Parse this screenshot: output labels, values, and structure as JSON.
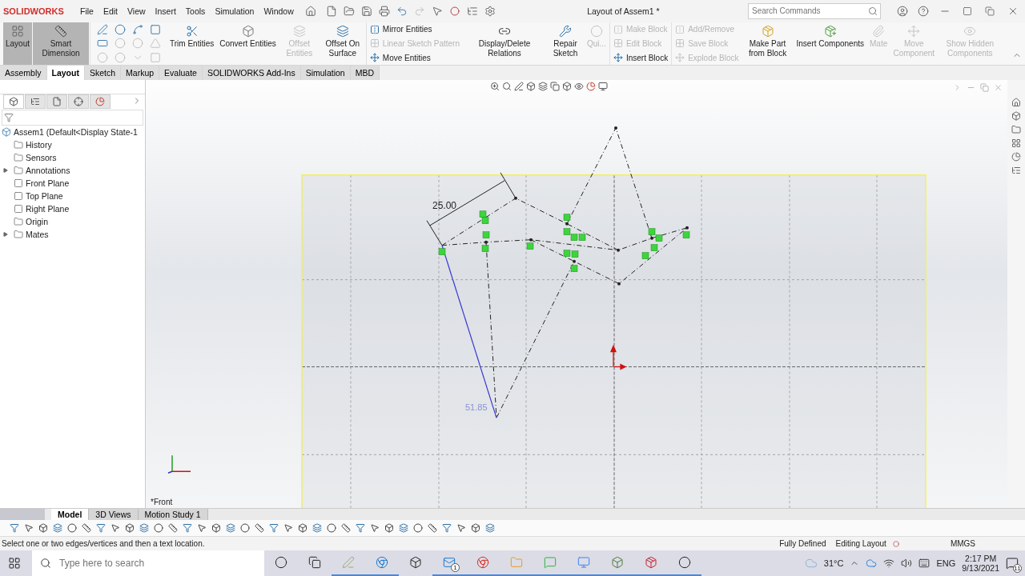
{
  "title_bar": {
    "brand": "SOLIDWORKS",
    "menu": [
      "File",
      "Edit",
      "View",
      "Insert",
      "Tools",
      "Simulation",
      "Window"
    ],
    "title": "Layout of Assem1 *",
    "search": {
      "placeholder": "Search Commands"
    }
  },
  "ribbon": [
    {
      "kind": "large",
      "label": "Layout",
      "selected": true,
      "disabled": false
    },
    {
      "kind": "large",
      "label": "Smart Dimension",
      "selected": true,
      "disabled": false
    },
    {
      "kind": "sketch_tools"
    },
    {
      "kind": "large",
      "label": "Trim Entities",
      "selected": false,
      "disabled": false
    },
    {
      "kind": "large",
      "label": "Convert Entities",
      "selected": false,
      "disabled": false
    },
    {
      "kind": "large",
      "label": "Offset Entities",
      "selected": false,
      "disabled": true
    },
    {
      "kind": "large",
      "label": "Offset On Surface",
      "selected": false,
      "disabled": false
    },
    {
      "kind": "stack",
      "items": [
        {
          "label": "Mirror Entities",
          "disabled": false
        },
        {
          "label": "Linear Sketch Pattern",
          "disabled": true
        },
        {
          "label": "Move Entities",
          "disabled": false
        }
      ]
    },
    {
      "kind": "large",
      "label": "Display/Delete Relations",
      "selected": false,
      "disabled": false
    },
    {
      "kind": "large",
      "label": "Repair Sketch",
      "selected": false,
      "disabled": false
    },
    {
      "kind": "large",
      "label": "Qui...",
      "selected": false,
      "disabled": true
    },
    {
      "kind": "stack",
      "items": [
        {
          "label": "Make Block",
          "disabled": true
        },
        {
          "label": "Edit Block",
          "disabled": true
        },
        {
          "label": "Insert Block",
          "disabled": false
        }
      ]
    },
    {
      "kind": "stack",
      "items": [
        {
          "label": "Add/Remove",
          "disabled": true
        },
        {
          "label": "Save Block",
          "disabled": true
        },
        {
          "label": "Explode Block",
          "disabled": true
        }
      ]
    },
    {
      "kind": "large",
      "label": "Make Part from Block",
      "selected": false,
      "disabled": false
    },
    {
      "kind": "large",
      "label": "Insert Components",
      "selected": false,
      "disabled": false
    },
    {
      "kind": "large",
      "label": "Mate",
      "selected": false,
      "disabled": true
    },
    {
      "kind": "large",
      "label": "Move Component",
      "selected": false,
      "disabled": true
    },
    {
      "kind": "large",
      "label": "Show Hidden Components",
      "selected": false,
      "disabled": true
    }
  ],
  "command_tabs": [
    {
      "label": "Assembly",
      "selected": false
    },
    {
      "label": "Layout",
      "selected": true
    },
    {
      "label": "Sketch",
      "selected": false
    },
    {
      "label": "Markup",
      "selected": false
    },
    {
      "label": "Evaluate",
      "selected": false
    },
    {
      "label": "SOLIDWORKS Add-Ins",
      "selected": false
    },
    {
      "label": "Simulation",
      "selected": false
    },
    {
      "label": "MBD",
      "selected": false
    }
  ],
  "feature_tree": {
    "label": "Assem1  (Default<Display State-1",
    "children": [
      {
        "label": "History",
        "expandable": false
      },
      {
        "label": "Sensors",
        "expandable": false
      },
      {
        "label": "Annotations",
        "expandable": true
      },
      {
        "label": "Front Plane",
        "expandable": false
      },
      {
        "label": "Top Plane",
        "expandable": false
      },
      {
        "label": "Right Plane",
        "expandable": false
      },
      {
        "label": "Origin",
        "expandable": false
      },
      {
        "label": "Mates",
        "expandable": true
      }
    ]
  },
  "sketch": {
    "dimension": "25.00",
    "dimension_preview": "51.85",
    "view_label": "*Front"
  },
  "bottom_tabs": [
    {
      "label": "Model",
      "selected": true
    },
    {
      "label": "3D Views",
      "selected": false
    },
    {
      "label": "Motion Study 1",
      "selected": false
    }
  ],
  "status_bar": {
    "prompt": "Select one or two edges/vertices and then a text location.",
    "state": "Fully Defined",
    "mode": "Editing Layout",
    "units": "MMGS"
  },
  "taskbar": {
    "search": {
      "placeholder": "Type here to search"
    },
    "mail_badge": "1",
    "weather": "31°C",
    "language": "ENG",
    "time": "2:17 PM",
    "date": "9/13/2021",
    "notifications": "11"
  }
}
